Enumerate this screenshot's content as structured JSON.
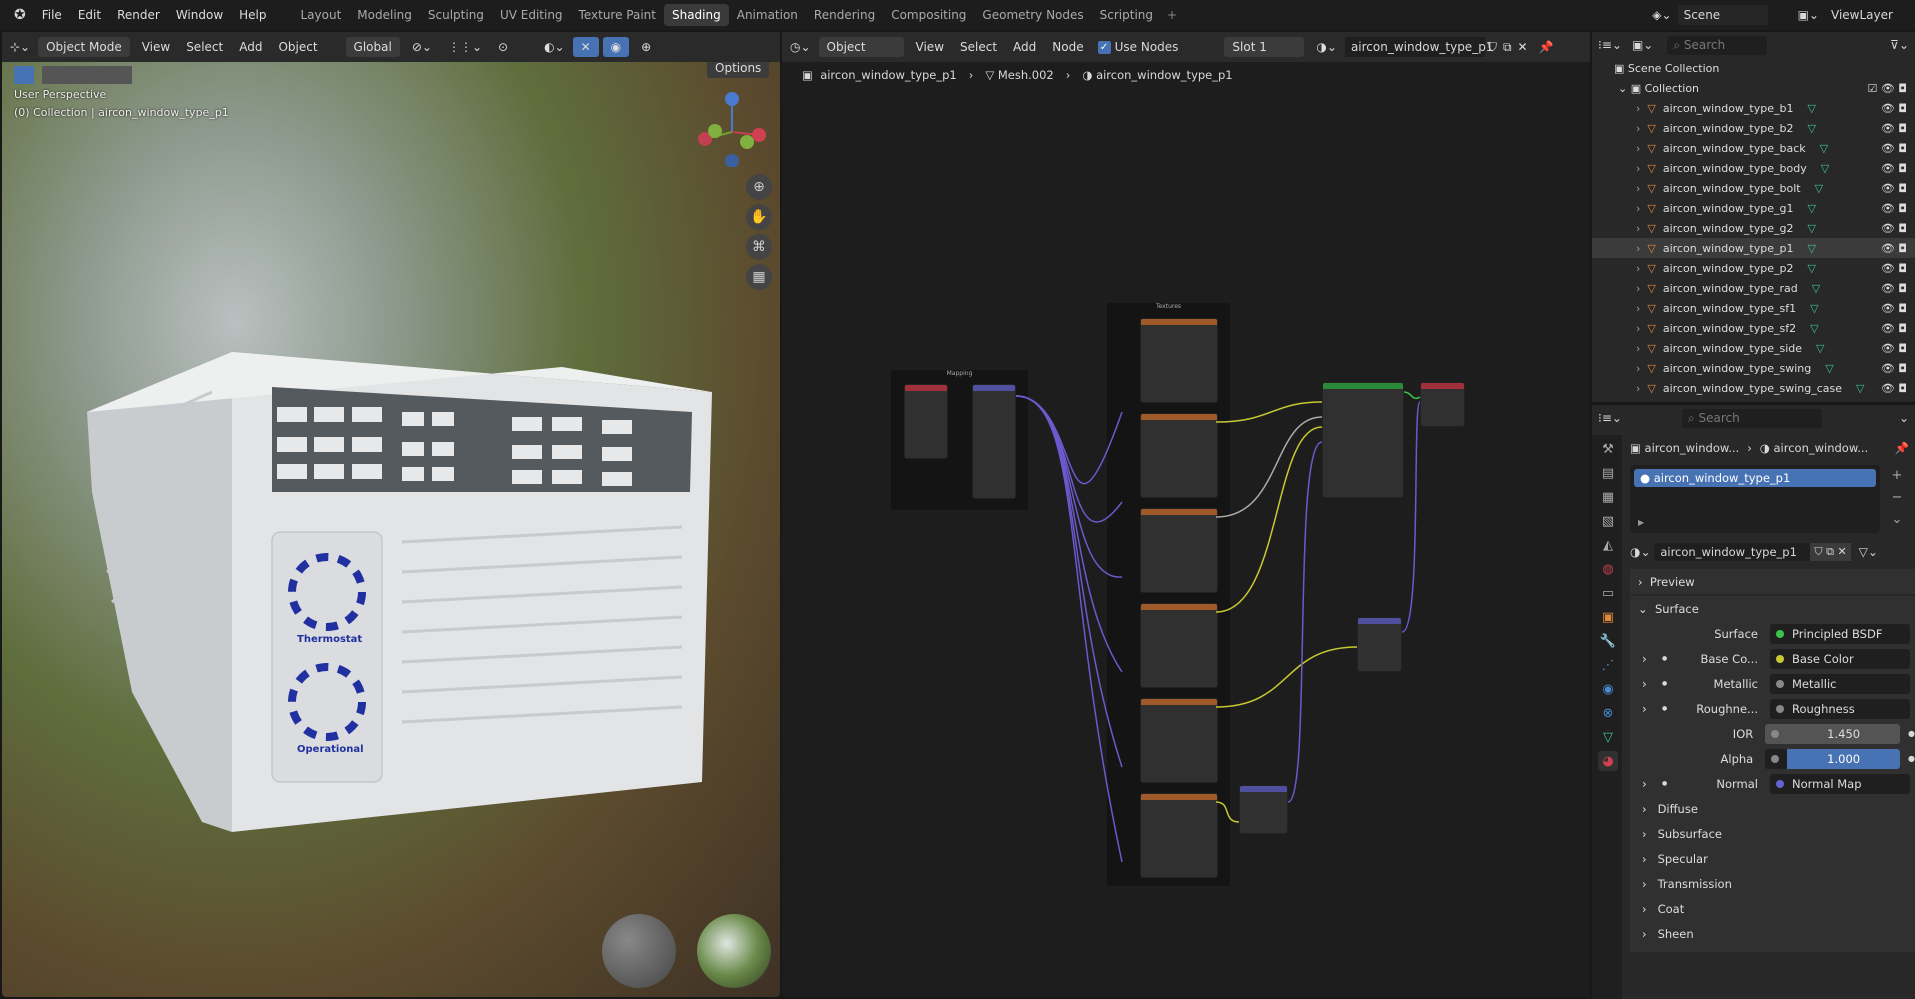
{
  "menu": [
    "File",
    "Edit",
    "Render",
    "Window",
    "Help"
  ],
  "workspaces": [
    {
      "label": "Layout"
    },
    {
      "label": "Modeling"
    },
    {
      "label": "Sculpting"
    },
    {
      "label": "UV Editing"
    },
    {
      "label": "Texture Paint"
    },
    {
      "label": "Shading",
      "active": true
    },
    {
      "label": "Animation"
    },
    {
      "label": "Rendering"
    },
    {
      "label": "Compositing"
    },
    {
      "label": "Geometry Nodes"
    },
    {
      "label": "Scripting"
    }
  ],
  "scene": "Scene",
  "view_layer": "ViewLayer",
  "viewport": {
    "mode": "Object Mode",
    "menus": [
      "View",
      "Select",
      "Add",
      "Object"
    ],
    "transform": "Global",
    "options": "Options",
    "perspective": "User Perspective",
    "collection_info": "(0) Collection | aircon_window_type_p1",
    "unit_labels": {
      "thermostat": "Thermostat",
      "operational": "Operational"
    }
  },
  "node_editor": {
    "object_type": "Object",
    "menus": [
      "View",
      "Select",
      "Add",
      "Node"
    ],
    "use_nodes": "Use Nodes",
    "slot": "Slot 1",
    "material": "aircon_window_type_p1",
    "breadcrumb": [
      "aircon_window_type_p1",
      "Mesh.002",
      "aircon_window_type_p1"
    ],
    "frames": {
      "mapping": "Mapping",
      "textures": "Textures"
    }
  },
  "outliner": {
    "search_placeholder": "Search",
    "scene_collection": "Scene Collection",
    "collection": "Collection",
    "items": [
      "aircon_window_type_b1",
      "aircon_window_type_b2",
      "aircon_window_type_back",
      "aircon_window_type_body",
      "aircon_window_type_bolt",
      "aircon_window_type_g1",
      "aircon_window_type_g2",
      "aircon_window_type_p1",
      "aircon_window_type_p2",
      "aircon_window_type_rad",
      "aircon_window_type_sf1",
      "aircon_window_type_sf2",
      "aircon_window_type_side",
      "aircon_window_type_swing",
      "aircon_window_type_swing_case"
    ],
    "selected_index": 7
  },
  "properties": {
    "search_placeholder": "Search",
    "breadcrumb": [
      "aircon_window...",
      "aircon_window..."
    ],
    "slot_item": "aircon_window_type_p1",
    "material_name": "aircon_window_type_p1",
    "preview": "Preview",
    "surface_section": "Surface",
    "surface": {
      "label": "Surface",
      "value": "Principled BSDF",
      "color": "#3cc44a"
    },
    "inputs": [
      {
        "label": "Base Co...",
        "value": "Base Color",
        "color": "#c8c832",
        "expand": true
      },
      {
        "label": "Metallic",
        "value": "Metallic",
        "color": "#888888",
        "expand": true
      },
      {
        "label": "Roughne...",
        "value": "Roughness",
        "color": "#888888",
        "expand": true
      }
    ],
    "ior": {
      "label": "IOR",
      "value": "1.450"
    },
    "alpha": {
      "label": "Alpha",
      "value": "1.000",
      "fraction": 1.0
    },
    "normal": {
      "label": "Normal",
      "value": "Normal Map",
      "color": "#6464d0"
    },
    "subsections": [
      "Diffuse",
      "Subsurface",
      "Specular",
      "Transmission",
      "Coat",
      "Sheen"
    ]
  }
}
